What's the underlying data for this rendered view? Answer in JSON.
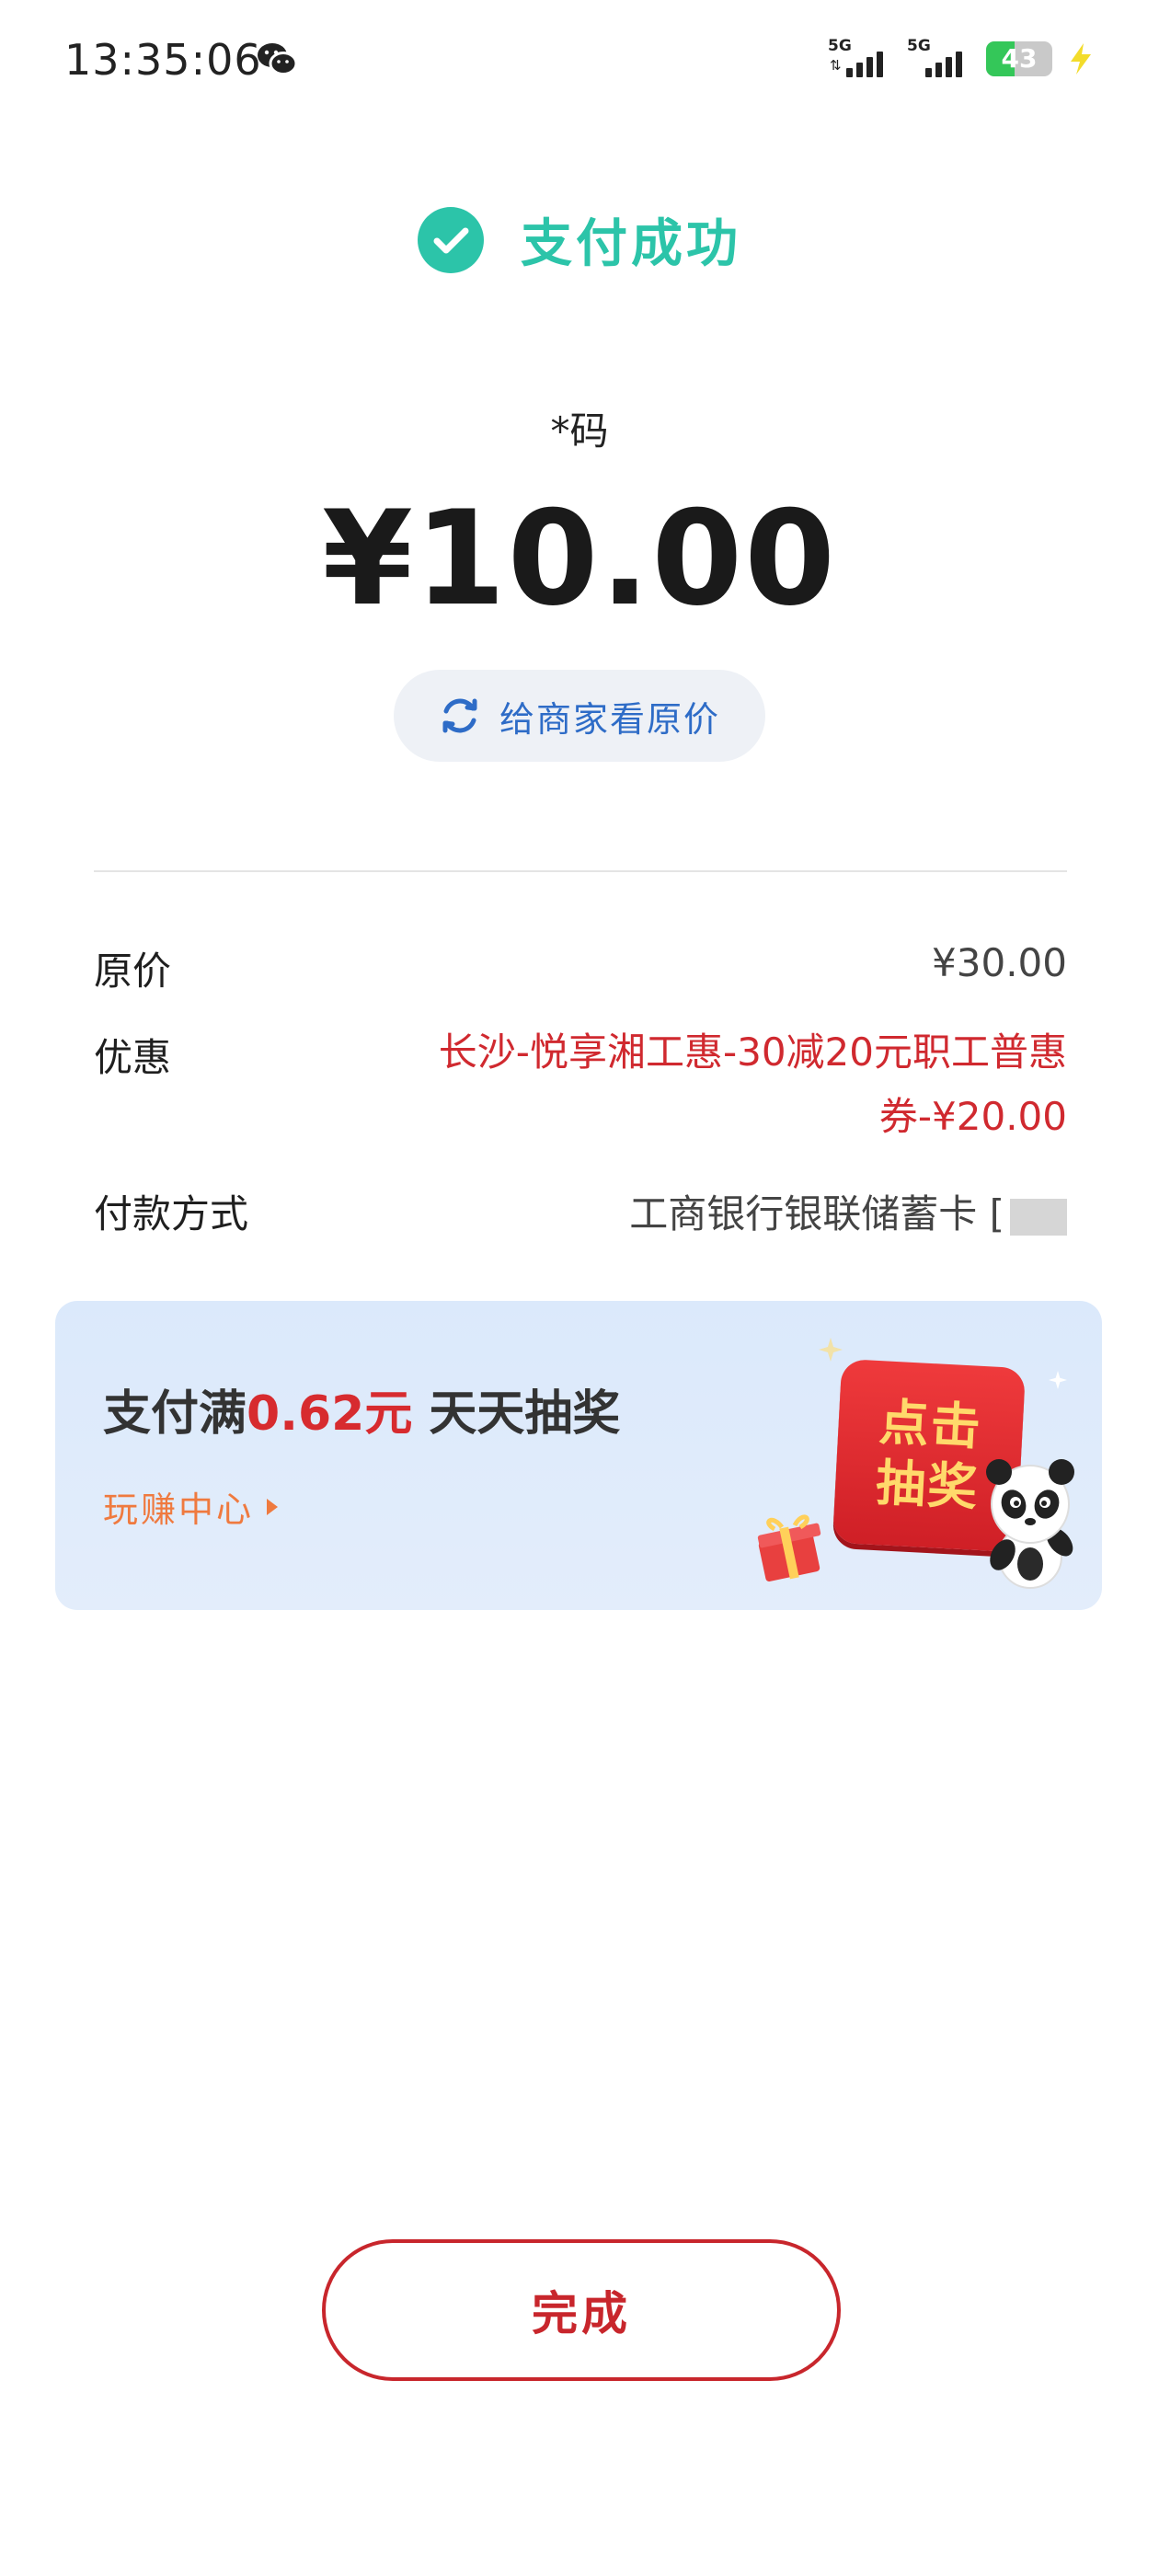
{
  "status_bar": {
    "time": "13:35:06",
    "network_1": "5G",
    "network_2": "5G",
    "battery": "43"
  },
  "header": {
    "title": "支付成功"
  },
  "payment": {
    "merchant": "*码",
    "amount": "¥10.00",
    "show_original_label": "给商家看原价"
  },
  "details": {
    "original_price_label": "原价",
    "original_price_value": "¥30.00",
    "discount_label": "优惠",
    "discount_value": "长沙-悦享湘工惠-30减20元职工普惠券-¥20.00",
    "payment_method_label": "付款方式",
    "payment_method_value": "工商银行银联储蓄卡 ["
  },
  "banner": {
    "title_prefix": "支付满",
    "title_highlight": "0.62元",
    "title_suffix": " 天天抽奖",
    "link_label": "玩赚中心",
    "button_line1": "点击",
    "button_line2": "抽奖"
  },
  "footer": {
    "done_label": "完成"
  },
  "colors": {
    "success": "#2cc4a9",
    "discount_red": "#d0292f",
    "link_blue": "#2e6cc7",
    "done_red": "#c8262c"
  }
}
